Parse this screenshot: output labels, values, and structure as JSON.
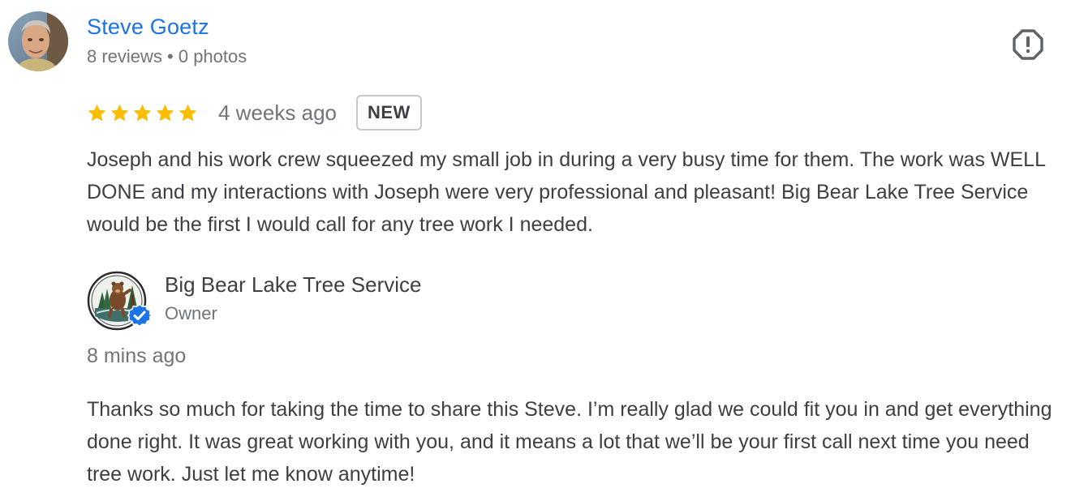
{
  "review": {
    "reviewer_name": "Steve Goetz",
    "reviewer_meta": "8 reviews • 0 photos",
    "rating": 5,
    "max_rating": 5,
    "time": "4 weeks ago",
    "badge": "NEW",
    "text": "Joseph and his work crew squeezed my small job in during a very busy time for them. The work was WELL DONE and my interactions with Joseph were very professional and pleasant! Big Bear Lake Tree Service would be the first I would call for any tree work I needed."
  },
  "owner_reply": {
    "name": "Big Bear Lake Tree Service",
    "role": "Owner",
    "time": "8 mins ago",
    "text": "Thanks so much for taking the time to share this Steve. I’m really glad we could fit you in and get everything done right. It was great working with you, and it means a lot that we’ll be your first call next time you need tree work. Just let me know anytime!"
  },
  "icons": {
    "flag": "report-flag-icon",
    "star": "star-icon",
    "verified": "verified-badge-icon"
  },
  "colors": {
    "name_link": "#1a73e8",
    "star": "#fbbc04",
    "secondary_text": "#70757a",
    "body_text": "#3c4043",
    "verified": "#1a73e8"
  }
}
